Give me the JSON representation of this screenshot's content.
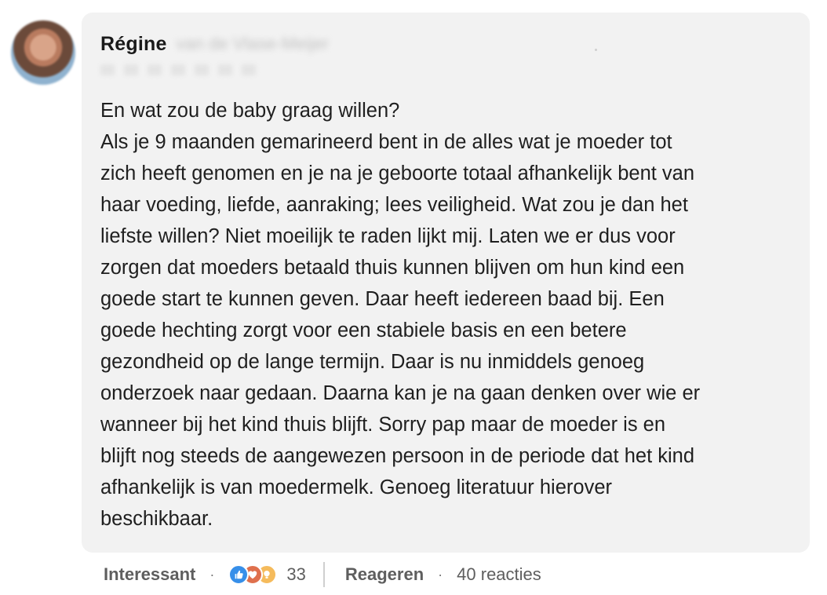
{
  "comment": {
    "author_first_name": "Régine",
    "author_rest_name": "van de Vlase-Meijer",
    "lines": [
      "En wat zou de baby graag willen?",
      "Als je 9 maanden gemarineerd bent in de alles wat je moeder tot",
      "zich heeft genomen en je na je geboorte totaal afhankelijk bent van",
      "haar voeding, liefde, aanraking; lees veiligheid. Wat zou je dan het",
      "liefste willen? Niet moeilijk te raden lijkt mij. Laten we er dus voor",
      "zorgen dat moeders betaald thuis kunnen blijven om hun kind een",
      "goede start te kunnen geven. Daar heeft iedereen baad bij. Een",
      "goede hechting zorgt voor een stabiele basis en een betere",
      "gezondheid op de lange termijn. Daar is nu inmiddels genoeg",
      "onderzoek naar gedaan. Daarna kan je na gaan denken over wie er",
      "wanneer bij het kind thuis blijft. Sorry pap maar de moeder is en",
      "blijft nog steeds de aangewezen persoon in de periode dat het kind",
      "afhankelijk is van moedermelk. Genoeg literatuur hierover",
      "beschikbaar."
    ]
  },
  "actions": {
    "react_label": "Interessant",
    "separator": "·",
    "reaction_icons": [
      "like-icon",
      "love-icon",
      "insightful-icon"
    ],
    "reaction_count": "33",
    "reply_label": "Reageren",
    "replies_text": "40 reacties"
  },
  "colors": {
    "bubble_bg": "#f2f2f2",
    "like": "#378fe9",
    "love": "#df704d",
    "insight": "#f5bb5c"
  }
}
